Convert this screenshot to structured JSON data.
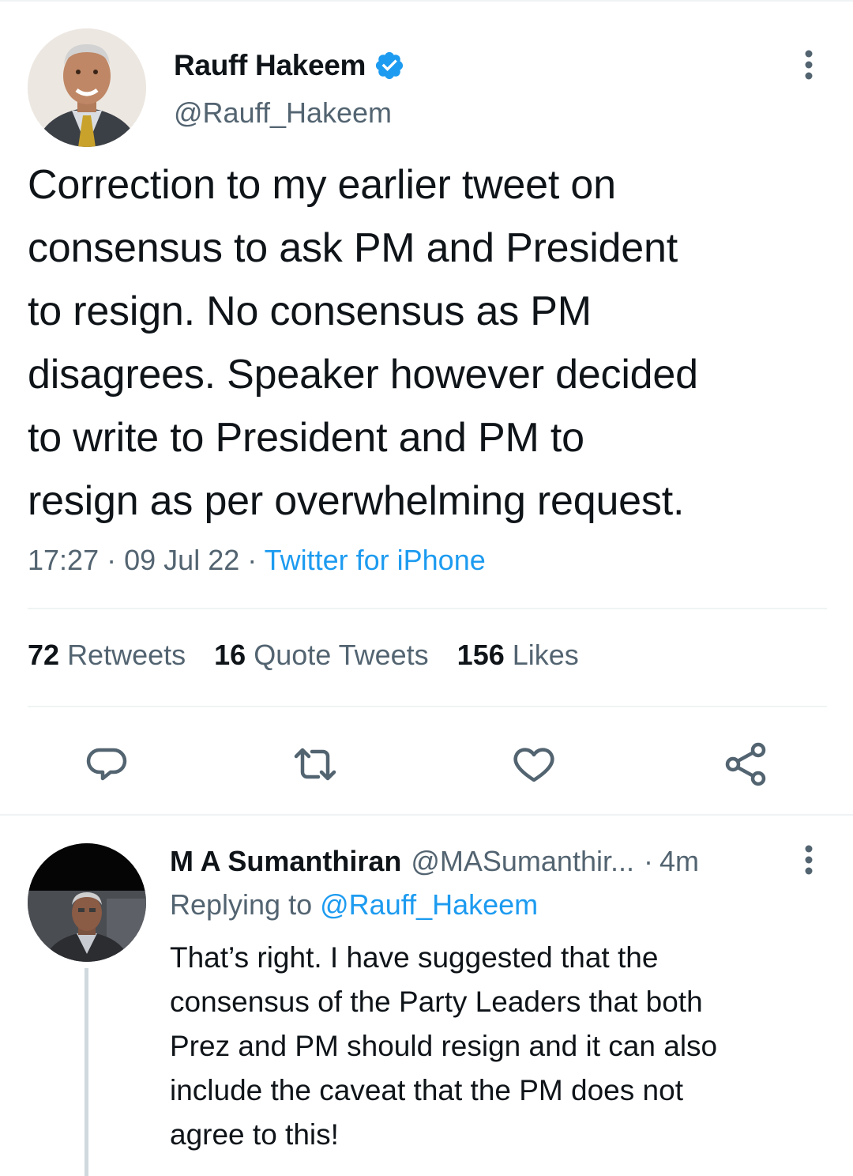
{
  "colors": {
    "accent": "#1d9bf0",
    "text_primary": "#0f1419",
    "text_secondary": "#536471",
    "divider": "#eff3f4",
    "thread_line": "#cfd9de"
  },
  "main_tweet": {
    "author": {
      "display_name": "Rauff Hakeem",
      "handle": "@Rauff_Hakeem",
      "verified_icon": "verified-badge-icon",
      "avatar": "avatar-photo"
    },
    "more_icon": "more-vertical-icon",
    "text": "Correction to my earlier tweet on\nconsensus to ask PM and President\nto resign. No consensus as PM\ndisagrees. Speaker however decided\nto write to President and PM to\nresign as per overwhelming request.",
    "time": "17:27",
    "date": "09 Jul 22",
    "separator": "·",
    "source": "Twitter for iPhone",
    "stats": [
      {
        "count": "72",
        "label": "Retweets"
      },
      {
        "count": "16",
        "label": "Quote Tweets"
      },
      {
        "count": "156",
        "label": "Likes"
      }
    ],
    "actions": [
      {
        "icon": "reply-icon"
      },
      {
        "icon": "retweet-icon"
      },
      {
        "icon": "like-icon"
      },
      {
        "icon": "share-icon"
      }
    ]
  },
  "reply": {
    "author": {
      "display_name": "M A Sumanthiran",
      "handle": "@MASumanthir...",
      "avatar": "avatar-photo"
    },
    "separator": "·",
    "time": "4m",
    "more_icon": "more-vertical-icon",
    "replying_to_label": "Replying to",
    "replying_to_handle": "@Rauff_Hakeem",
    "text": "That’s right. I have suggested that the\nconsensus of the Party Leaders that both\nPrez and PM should resign and it can also\ninclude the caveat that the PM does not\nagree to this!"
  }
}
